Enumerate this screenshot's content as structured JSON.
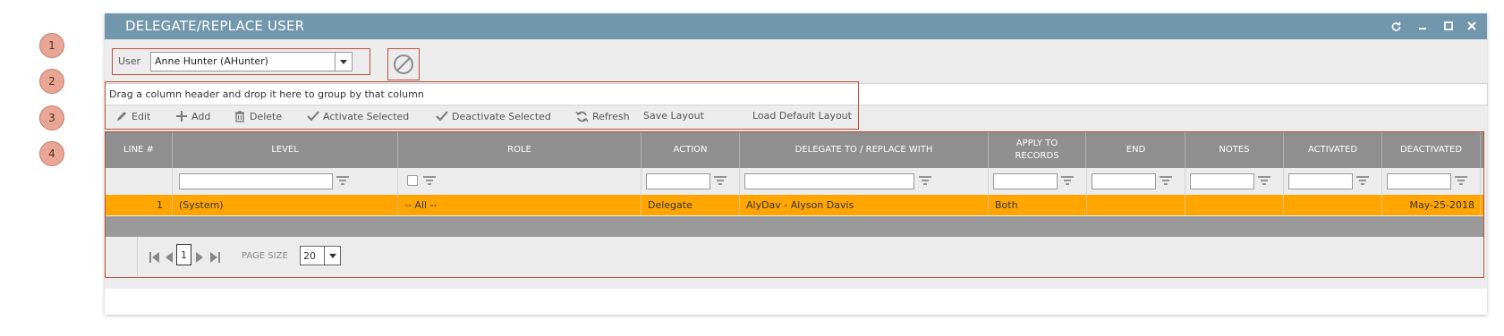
{
  "callouts": [
    "1",
    "2",
    "3",
    "4"
  ],
  "window": {
    "title": "DELEGATE/REPLACE USER",
    "controls": [
      "refresh-icon",
      "minimize-icon",
      "maximize-icon",
      "close-icon"
    ]
  },
  "user_select": {
    "label": "User",
    "value": "Anne Hunter (AHunter)"
  },
  "group_panel": {
    "text": "Drag a column header and drop it here to group by that column"
  },
  "toolbar": {
    "edit": "Edit",
    "add": "Add",
    "delete": "Delete",
    "activate": "Activate Selected",
    "deactivate": "Deactivate Selected",
    "refresh": "Refresh",
    "save_layout": "Save Layout",
    "load_default": "Load Default Layout"
  },
  "grid": {
    "columns": {
      "line": "LINE #",
      "level": "LEVEL",
      "role": "ROLE",
      "action": "ACTION",
      "delegate": "DELEGATE TO / REPLACE WITH",
      "apply": "APPLY TO RECORDS",
      "end": "END",
      "notes": "NOTES",
      "activated": "ACTIVATED",
      "deactivated": "DEACTIVATED"
    },
    "rows": [
      {
        "line": "1",
        "level": "(System)",
        "role": "-- All --",
        "action": "Delegate",
        "delegate": "AlyDav - Alyson Davis",
        "apply": "Both",
        "end": "",
        "notes": "",
        "activated": "",
        "deactivated": "May-25-2018"
      }
    ],
    "selected_row_color": "#ffa500"
  },
  "pager": {
    "current_page": "1",
    "page_size_label": "PAGE SIZE",
    "page_size": "20"
  },
  "colors": {
    "titlebar": "#7297ad",
    "header": "#8f8f8f",
    "highlight_border": "#b5533c"
  }
}
